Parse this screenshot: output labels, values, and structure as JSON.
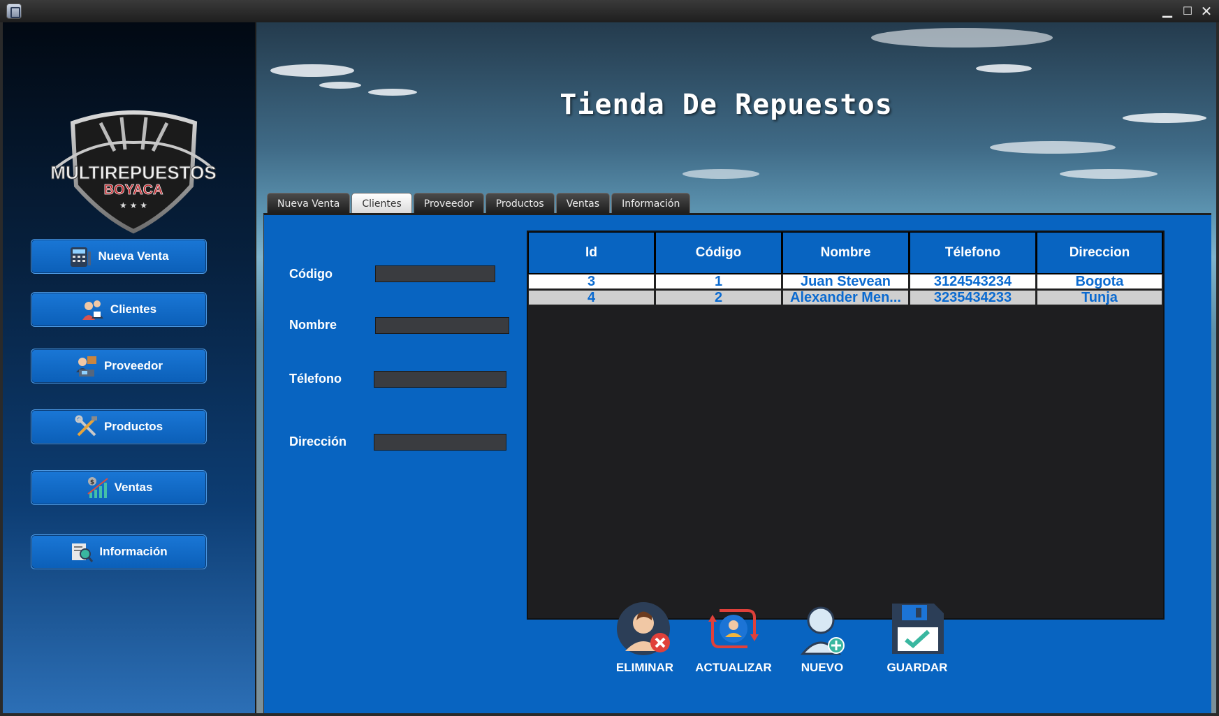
{
  "window": {
    "app_icon": "app-icon",
    "controls": {
      "minimize": "▁",
      "maximize": "☐",
      "close": "✕"
    }
  },
  "sidebar": {
    "logo": {
      "line1": "MULTIREPUESTOS",
      "line2": "BOYACA"
    },
    "items": [
      {
        "label": "Nueva Venta",
        "icon": "cash-register-icon"
      },
      {
        "label": "Clientes",
        "icon": "clients-icon"
      },
      {
        "label": "Proveedor",
        "icon": "supplier-icon"
      },
      {
        "label": "Productos",
        "icon": "tools-icon"
      },
      {
        "label": "Ventas",
        "icon": "sales-chart-icon"
      },
      {
        "label": "Información",
        "icon": "info-search-icon"
      }
    ]
  },
  "header": {
    "title": "Tienda De Repuestos"
  },
  "tabs": [
    {
      "label": "Nueva Venta"
    },
    {
      "label": "Clientes"
    },
    {
      "label": "Proveedor"
    },
    {
      "label": "Productos"
    },
    {
      "label": "Ventas"
    },
    {
      "label": "Información"
    }
  ],
  "active_tab": "Clientes",
  "form": {
    "codigo": {
      "label": "Código",
      "value": ""
    },
    "nombre": {
      "label": "Nombre",
      "value": ""
    },
    "telefono": {
      "label": "Télefono",
      "value": ""
    },
    "direccion": {
      "label": "Dirección",
      "value": ""
    }
  },
  "table": {
    "columns": [
      "Id",
      "Código",
      "Nombre",
      "Télefono",
      "Direccion"
    ],
    "rows": [
      [
        "3",
        "1",
        "Juan Stevean",
        "3124543234",
        "Bogota"
      ],
      [
        "4",
        "2",
        "Alexander Men...",
        "3235434233",
        "Tunja"
      ]
    ]
  },
  "actions": {
    "eliminar": "ELIMINAR",
    "actualizar": "ACTUALIZAR",
    "nuevo": "NUEVO",
    "guardar": "GUARDAR"
  },
  "colors": {
    "panel": "#0864c1",
    "button": "#1a77d6",
    "table_text": "#0a6ad0",
    "table_bg": "#1e1e20"
  }
}
